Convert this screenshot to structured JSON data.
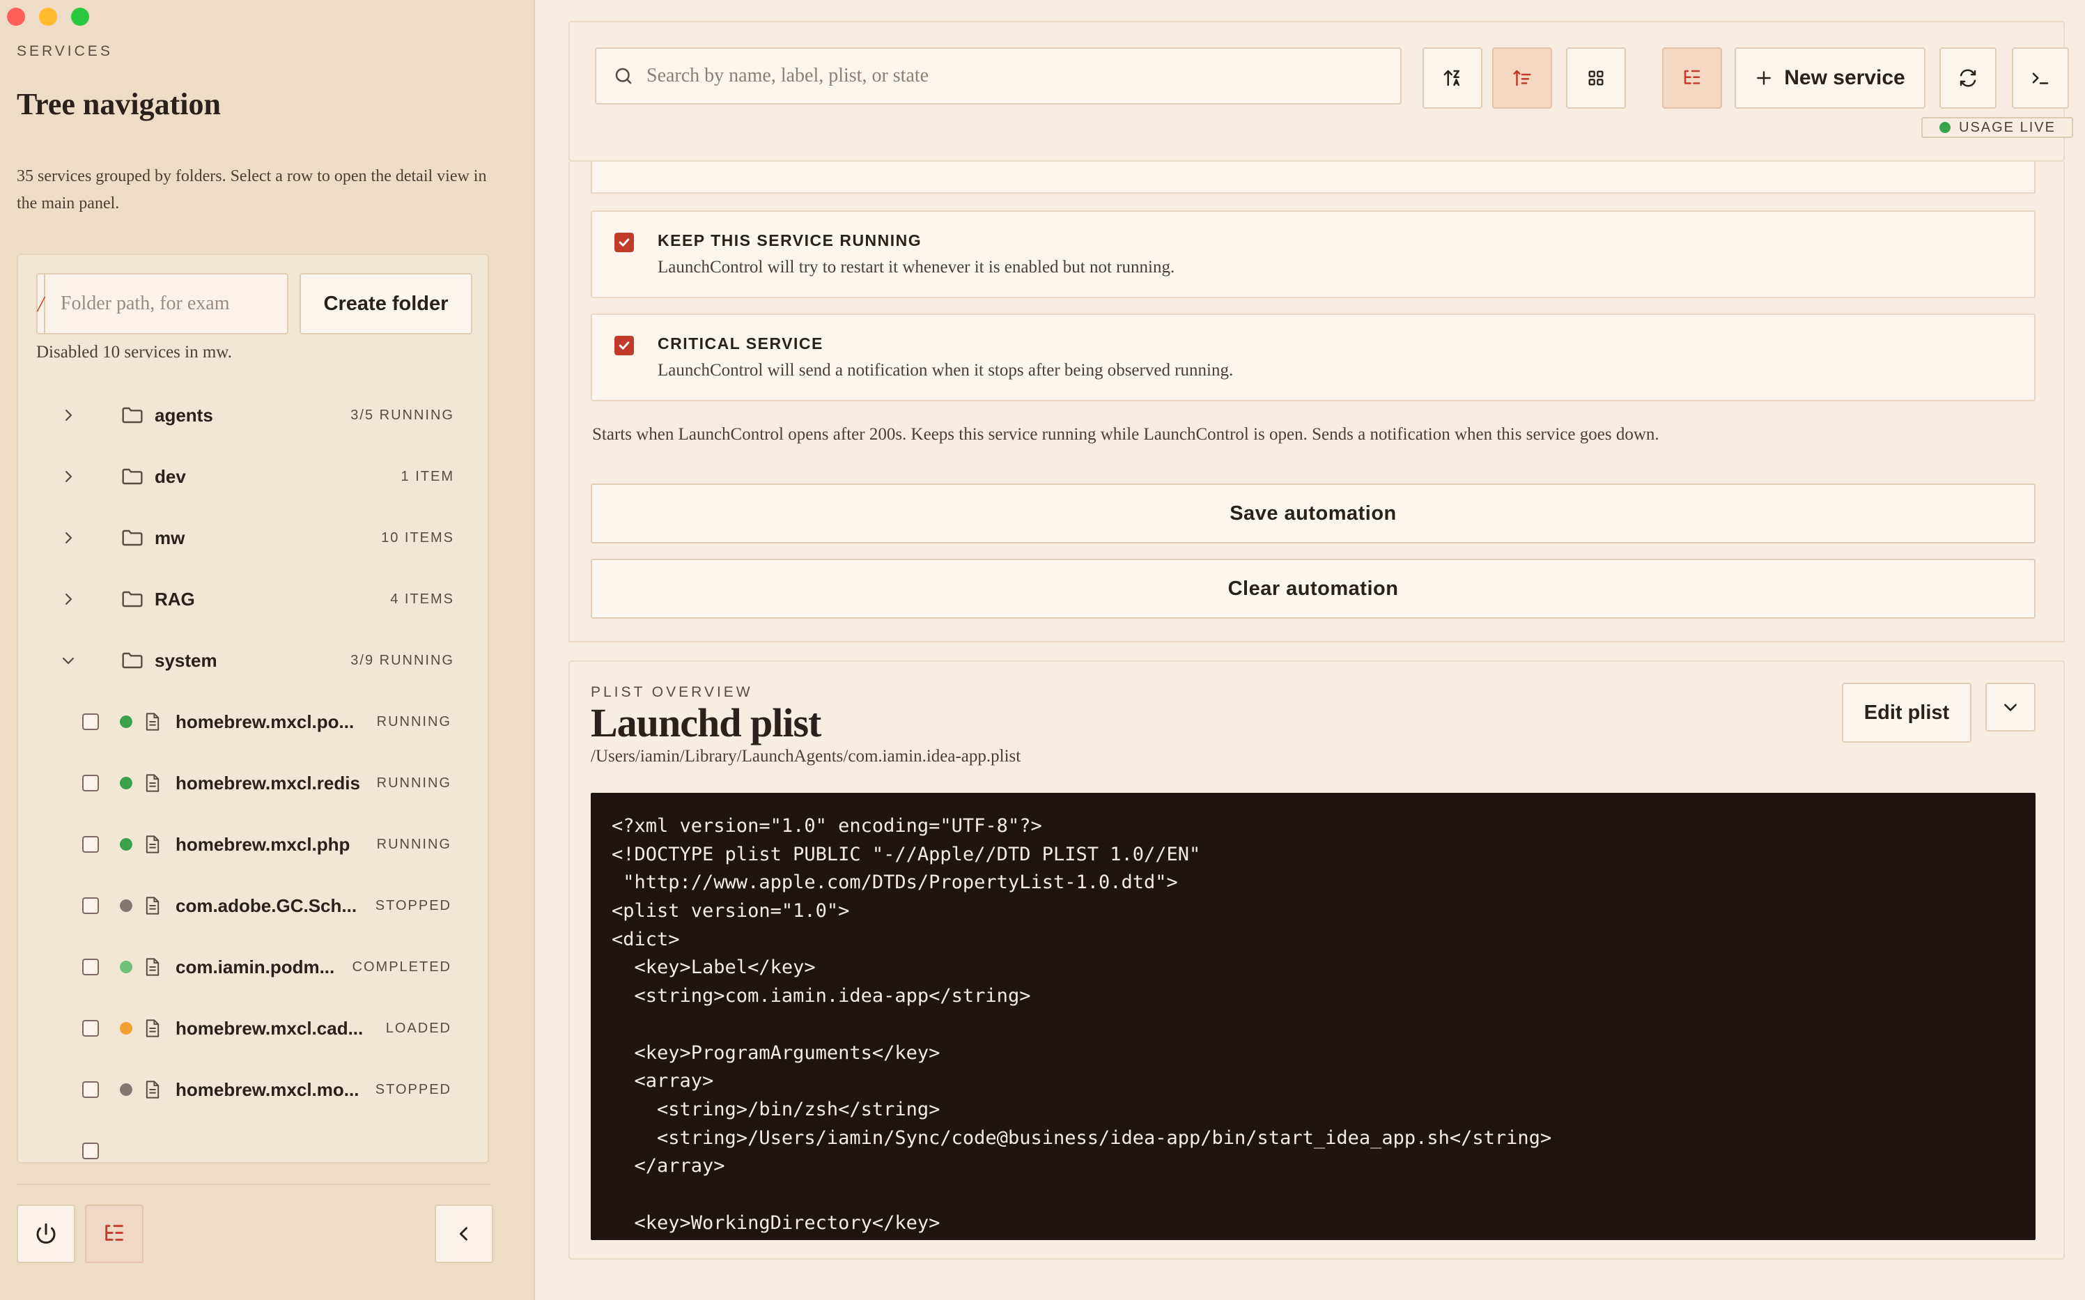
{
  "sidebar": {
    "eyebrow": "SERVICES",
    "title": "Tree navigation",
    "description": "35 services grouped by folders. Select a row to open the detail view in the main panel.",
    "folder_prefix": "/",
    "folder_placeholder": "Folder path, for exam",
    "create_folder_label": "Create folder",
    "status_message": "Disabled 10 services in mw.",
    "folders": [
      {
        "name": "agents",
        "count": "3/5 RUNNING",
        "expanded": false
      },
      {
        "name": "dev",
        "count": "1 ITEM",
        "expanded": false
      },
      {
        "name": "mw",
        "count": "10 ITEMS",
        "expanded": false
      },
      {
        "name": "RAG",
        "count": "4 ITEMS",
        "expanded": false
      },
      {
        "name": "system",
        "count": "3/9 RUNNING",
        "expanded": true
      }
    ],
    "services": [
      {
        "name": "homebrew.mxcl.po...",
        "state": "RUNNING",
        "dot": "#3aa24c"
      },
      {
        "name": "homebrew.mxcl.redis",
        "state": "RUNNING",
        "dot": "#3aa24c"
      },
      {
        "name": "homebrew.mxcl.php",
        "state": "RUNNING",
        "dot": "#3aa24c"
      },
      {
        "name": "com.adobe.GC.Sch...",
        "state": "STOPPED",
        "dot": "#857770"
      },
      {
        "name": "com.iamin.podm...",
        "state": "COMPLETED",
        "dot": "#6fc07a"
      },
      {
        "name": "homebrew.mxcl.cad...",
        "state": "LOADED",
        "dot": "#f0a132"
      },
      {
        "name": "homebrew.mxcl.mo...",
        "state": "STOPPED",
        "dot": "#857770"
      }
    ],
    "footer": {
      "power_icon": "power-icon",
      "tree_icon": "tree-list-icon",
      "collapse_icon": "chevron-left-icon"
    }
  },
  "toolbar": {
    "search_placeholder": "Search by name, label, plist, or state",
    "new_service_label": "New service",
    "usage_label": "USAGE LIVE",
    "icons": [
      "sort-alpha-icon",
      "sort-filter-icon",
      "grid-view-icon",
      "tree-view-icon",
      "refresh-icon",
      "terminal-icon"
    ]
  },
  "automation": {
    "options": [
      {
        "title": "KEEP THIS SERVICE RUNNING",
        "description": "LaunchControl will try to restart it whenever it is enabled but not running.",
        "checked": true
      },
      {
        "title": "CRITICAL SERVICE",
        "description": "LaunchControl will send a notification when it stops after being observed running.",
        "checked": true
      }
    ],
    "summary": "Starts when LaunchControl opens after 200s. Keeps this service running while LaunchControl is open. Sends a notification when this service goes down.",
    "save_label": "Save automation",
    "clear_label": "Clear automation"
  },
  "plist": {
    "eyebrow": "PLIST OVERVIEW",
    "title": "Launchd plist",
    "path": "/Users/iamin/Library/LaunchAgents/com.iamin.idea-app.plist",
    "edit_label": "Edit plist",
    "code_lines": [
      "<?xml version=\"1.0\" encoding=\"UTF-8\"?>",
      "<!DOCTYPE plist PUBLIC \"-//Apple//DTD PLIST 1.0//EN\"",
      " \"http://www.apple.com/DTDs/PropertyList-1.0.dtd\">",
      "<plist version=\"1.0\">",
      "<dict>",
      "  <key>Label</key>",
      "  <string>com.iamin.idea-app</string>",
      "",
      "  <key>ProgramArguments</key>",
      "  <array>",
      "    <string>/bin/zsh</string>",
      "    <string>/Users/iamin/Sync/code@business/idea-app/bin/start_idea_app.sh</string>",
      "  </array>",
      "",
      "  <key>WorkingDirectory</key>"
    ]
  },
  "colors": {
    "accent": "#c23b2a",
    "sidebar_bg": "#efdcc6",
    "main_bg": "#f6ece0",
    "code_bg": "#1e1512"
  }
}
